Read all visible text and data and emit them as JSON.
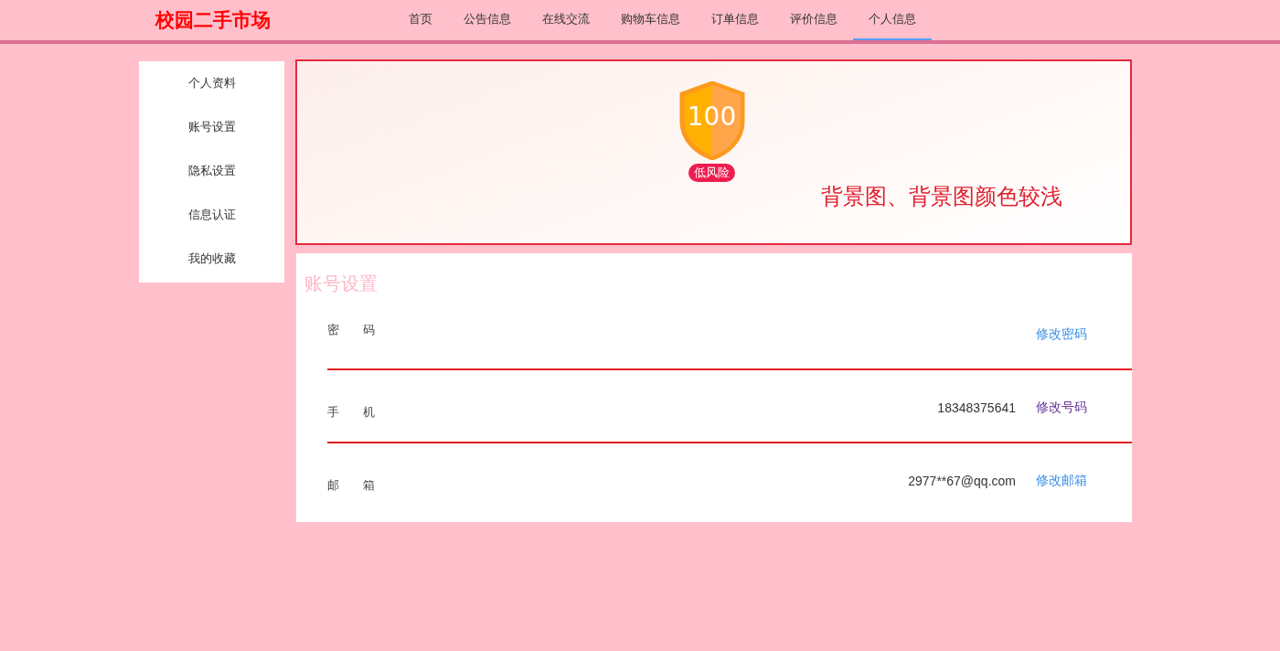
{
  "header": {
    "logo": "校园二手市场",
    "nav": [
      {
        "label": "首页",
        "selected": false
      },
      {
        "label": "公告信息",
        "selected": false
      },
      {
        "label": "在线交流",
        "selected": false
      },
      {
        "label": "购物车信息",
        "selected": false
      },
      {
        "label": "订单信息",
        "selected": false
      },
      {
        "label": "评价信息",
        "selected": false
      },
      {
        "label": "个人信息",
        "selected": true
      }
    ]
  },
  "sidebar": {
    "items": [
      {
        "label": "个人资料"
      },
      {
        "label": "账号设置"
      },
      {
        "label": "隐私设置"
      },
      {
        "label": "信息认证"
      },
      {
        "label": "我的收藏"
      }
    ]
  },
  "banner": {
    "score": "100",
    "risk": "低风险",
    "caption": "背景图、背景图颜色较浅"
  },
  "account": {
    "title": "账号设置",
    "rows": [
      {
        "label": "密　　码",
        "action": "修改密码",
        "visited": false
      },
      {
        "label": "手　　机",
        "value": "18348375641",
        "action": "修改号码",
        "visited": true
      },
      {
        "label": "邮　　箱",
        "value": "2977**67@qq.com",
        "action": "修改邮箱",
        "visited": false
      }
    ]
  }
}
